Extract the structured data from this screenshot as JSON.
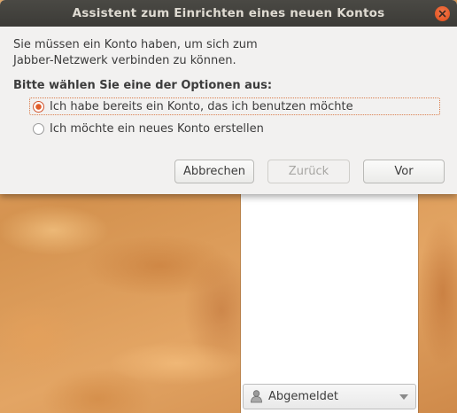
{
  "dialog": {
    "title": "Assistent zum Einrichten eines neuen Kontos",
    "intro_line1": "Sie müssen ein Konto haben, um sich zum",
    "intro_line2": "Jabber-Netzwerk verbinden zu können.",
    "options_heading": "Bitte wählen Sie eine der Optionen aus:",
    "options": [
      {
        "label": "Ich habe bereits ein Konto, das ich benutzen möchte",
        "selected": true
      },
      {
        "label": "Ich möchte ein neues Konto erstellen",
        "selected": false
      }
    ],
    "buttons": {
      "cancel": "Abbrechen",
      "back": "Zurück",
      "next": "Vor"
    },
    "back_enabled": false
  },
  "background_window": {
    "status": {
      "label": "Abgemeldet",
      "icon": "offline-person-icon"
    }
  },
  "colors": {
    "titlebar": "#3c3b37",
    "close_button": "#df4a16",
    "accent": "#d2542e",
    "dialog_bg": "#f2f1f0",
    "wallpaper": "#d7955a"
  }
}
